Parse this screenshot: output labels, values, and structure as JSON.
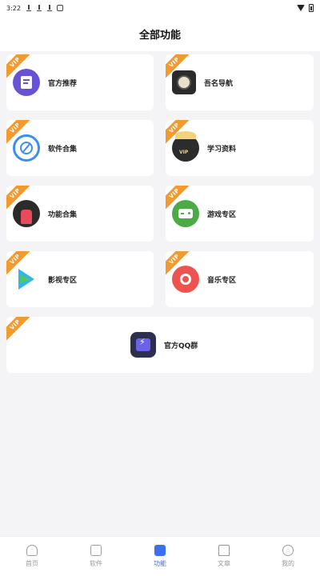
{
  "status_bar": {
    "time": "3:22"
  },
  "header": {
    "title": "全部功能"
  },
  "cards": [
    {
      "label": "官方推荐",
      "badge": "VIP",
      "icon": "official-recommend-icon"
    },
    {
      "label": "吾名导航",
      "badge": "VIP",
      "icon": "navigation-icon"
    },
    {
      "label": "软件合集",
      "badge": "VIP",
      "icon": "software-icon"
    },
    {
      "label": "学习资料",
      "badge": "VIP",
      "icon": "study-icon"
    },
    {
      "label": "功能合集",
      "badge": "VIP",
      "icon": "function-icon"
    },
    {
      "label": "游戏专区",
      "badge": "VIP",
      "icon": "game-icon"
    },
    {
      "label": "影视专区",
      "badge": "VIP",
      "icon": "video-icon"
    },
    {
      "label": "音乐专区",
      "badge": "VIP",
      "icon": "music-icon"
    },
    {
      "label": "官方QQ群",
      "badge": "VIP",
      "icon": "qq-group-icon"
    }
  ],
  "study_icon_text": "VIP",
  "bottom_nav": [
    {
      "label": "首页",
      "active": false
    },
    {
      "label": "软件",
      "active": false
    },
    {
      "label": "功能",
      "active": true
    },
    {
      "label": "文章",
      "active": false
    },
    {
      "label": "我的",
      "active": false
    }
  ],
  "colors": {
    "accent": "#3b6ff0",
    "vip_badge": "#f29a2e",
    "background": "#f4f4f6"
  }
}
